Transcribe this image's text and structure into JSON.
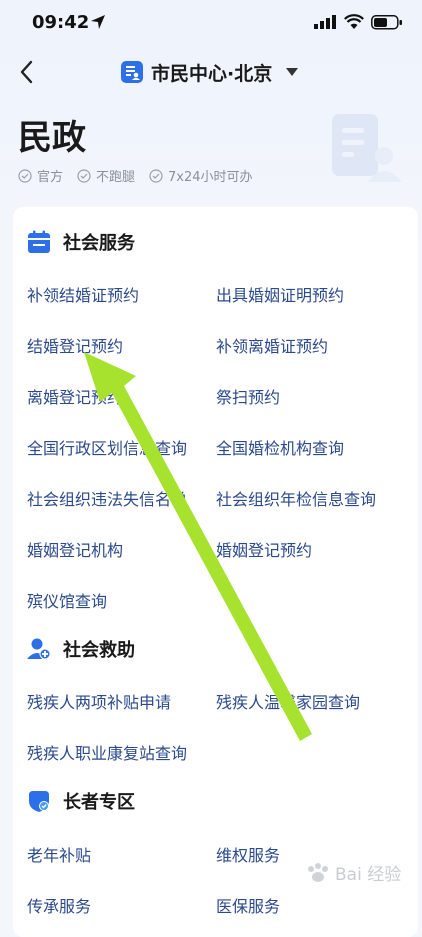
{
  "status": {
    "time": "09:42"
  },
  "nav": {
    "title": "市民中心·北京"
  },
  "page": {
    "title": "民政",
    "tags": [
      "官方",
      "不跑腿",
      "7x24小时可办"
    ]
  },
  "sections": [
    {
      "title": "社会服务",
      "items": [
        "补领结婚证预约",
        "出具婚姻证明预约",
        "结婚登记预约",
        "补领离婚证预约",
        "离婚登记预约",
        "祭扫预约",
        "全国行政区划信息查询",
        "全国婚检机构查询",
        "社会组织违法失信名单",
        "社会组织年检信息查询",
        "婚姻登记机构",
        "婚姻登记预约",
        "殡仪馆查询"
      ]
    },
    {
      "title": "社会救助",
      "items": [
        "残疾人两项补贴申请",
        "残疾人温馨家园查询",
        "残疾人职业康复站查询"
      ]
    },
    {
      "title": "长者专区",
      "items": [
        "老年补贴",
        "维权服务",
        "传承服务",
        "医保服务"
      ]
    }
  ],
  "watermark": {
    "text": "Bai 经验"
  },
  "colors": {
    "accent": "#2d6fe8",
    "link": "#2b4a8c",
    "arrow": "#a6e22e"
  }
}
